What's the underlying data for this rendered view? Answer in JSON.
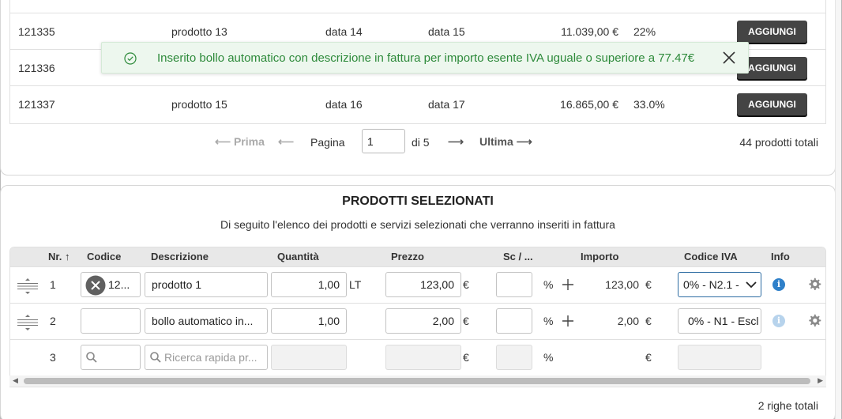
{
  "products": {
    "add_label": "AGGIUNGI",
    "rows": [
      {
        "code": "121335",
        "name": "prodotto 13",
        "date1": "data 14",
        "date2": "data 15",
        "price": "11.039,00 €",
        "pct": "22%"
      },
      {
        "code": "121336",
        "name": "",
        "date1": "",
        "date2": "",
        "price": "",
        "pct": ""
      },
      {
        "code": "121337",
        "name": "prodotto 15",
        "date1": "data 16",
        "date2": "data 17",
        "price": "16.865,00 €",
        "pct": "33.0%"
      }
    ]
  },
  "pager": {
    "first": "Prima",
    "page_label": "Pagina",
    "page_value": "1",
    "of_label": "di 5",
    "last": "Ultima",
    "total": "44 prodotti totali",
    "arrow_left": "⟵",
    "arrow_right": "⟶"
  },
  "toast": {
    "message": "Inserito bollo automatico con descrizione in fattura per importo esente IVA uguale o superiore a 77.47€",
    "color": "#2d8a3a"
  },
  "selected": {
    "title": "PRODOTTI SELEZIONATI",
    "subtitle": "Di seguito l'elenco dei prodotti e servizi selezionati che verranno inseriti in fattura",
    "headers": {
      "nr": "Nr. ↑",
      "code": "Codice",
      "desc": "Descrizione",
      "qty": "Quantità",
      "price": "Prezzo",
      "disc": "Sc / ...",
      "amount": "Importo",
      "vat": "Codice IVA",
      "info": "Info"
    },
    "rows": [
      {
        "nr": "1",
        "code": "12...",
        "desc": "prodotto 1",
        "qty": "1,00",
        "unit": "LT",
        "price": "123,00",
        "currency": "€",
        "disc": "",
        "pct": "%",
        "amount": "123,00",
        "amount_cur": "€",
        "vat": "0% - N2.1 -"
      },
      {
        "nr": "2",
        "code": "",
        "desc": "bollo automatico in...",
        "qty": "1,00",
        "unit": "",
        "price": "2,00",
        "currency": "€",
        "disc": "",
        "pct": "%",
        "amount": "2,00",
        "amount_cur": "€",
        "vat": "0% - N1 - Escl"
      },
      {
        "nr": "3",
        "code_placeholder": "",
        "desc_placeholder": "Ricerca rapida pr...",
        "currency": "€",
        "pct": "%",
        "amount_cur": "€"
      }
    ],
    "rows_total": "2 righe totali"
  },
  "colors": {
    "info_active": "#2f80c9",
    "info_inactive": "#b7d3ec",
    "button_dark": "#444444"
  }
}
